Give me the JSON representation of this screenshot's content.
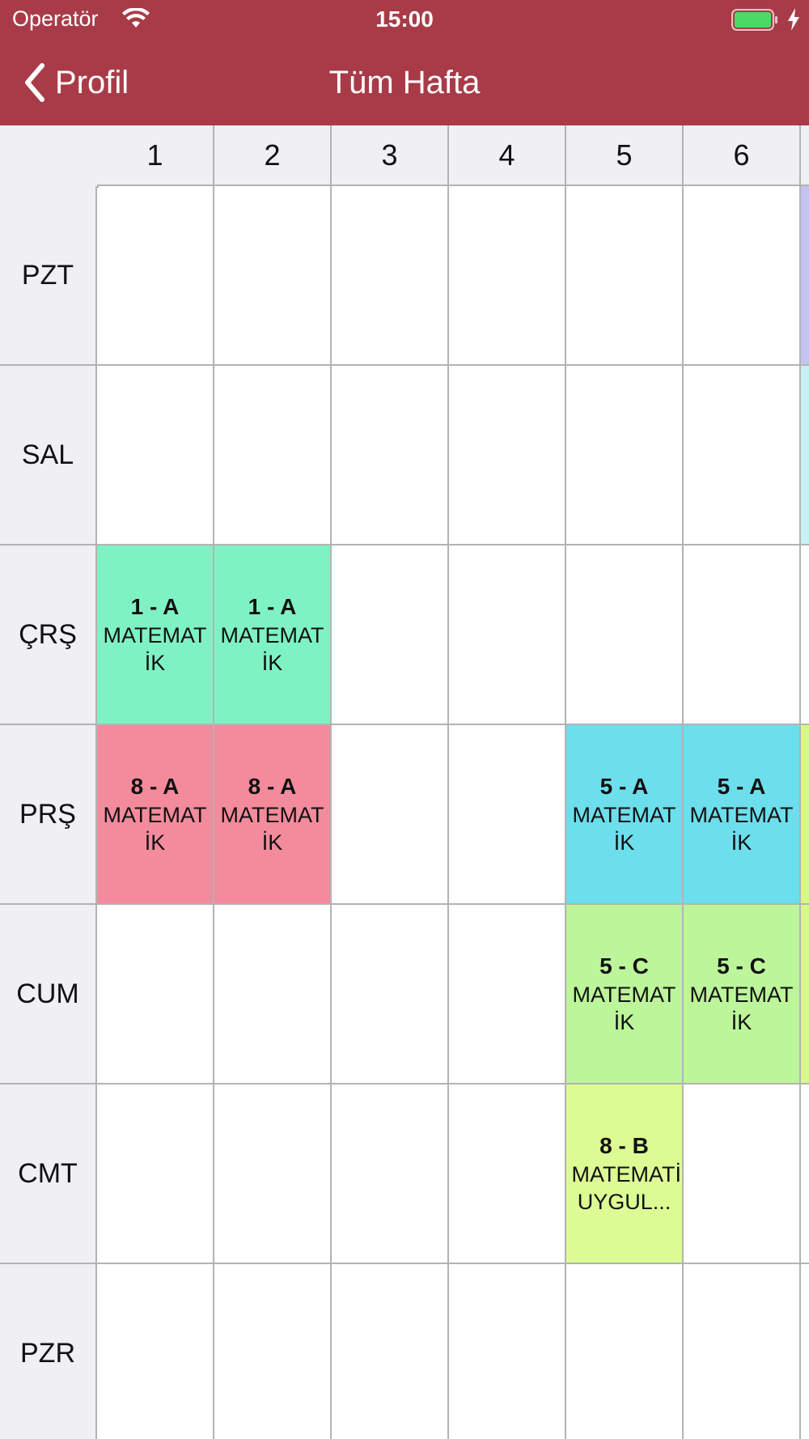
{
  "status_bar": {
    "carrier": "Operatör",
    "time": "15:00"
  },
  "nav": {
    "back_label": "Profil",
    "title": "Tüm Hafta"
  },
  "timetable": {
    "periods": [
      "1",
      "2",
      "3",
      "4",
      "5",
      "6"
    ],
    "days": [
      "PZT",
      "SAL",
      "ÇRŞ",
      "PRŞ",
      "CUM",
      "CMT",
      "PZR"
    ],
    "lessons": {
      "crs": {
        "p1": {
          "class": "1 - A",
          "subject": "MATEMATİK",
          "color": "#7ff2c3"
        },
        "p2": {
          "class": "1 - A",
          "subject": "MATEMATİK",
          "color": "#7ff2c3"
        }
      },
      "prs": {
        "p1": {
          "class": "8 - A",
          "subject": "MATEMATİK",
          "color": "#f48b9d"
        },
        "p2": {
          "class": "8 - A",
          "subject": "MATEMATİK",
          "color": "#f48b9d"
        },
        "p5": {
          "class": "5 - A",
          "subject": "MATEMATİK",
          "color": "#6cdeec"
        },
        "p6": {
          "class": "5 - A",
          "subject": "MATEMATİK",
          "color": "#6cdeec"
        }
      },
      "cum": {
        "p5": {
          "class": "5 - C",
          "subject": "MATEMATİK",
          "color": "#bcf59a"
        },
        "p6": {
          "class": "5 - C",
          "subject": "MATEMATİK",
          "color": "#bcf59a"
        }
      },
      "cmt": {
        "p5": {
          "class": "8 - B",
          "subject": "MATEMATİK UYGUL...",
          "color": "#ddfb94"
        }
      }
    },
    "next_column_colors": {
      "pzt": "#c5c3f1",
      "sal": "#c6f2f4",
      "prs": "#d8f98a",
      "cum": "#d8f98a"
    }
  }
}
